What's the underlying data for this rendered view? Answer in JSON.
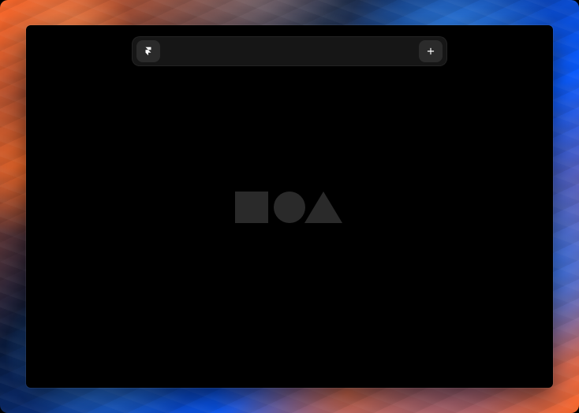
{
  "screen": {
    "wallpaper": "orange-blue-marbled"
  },
  "colors": {
    "window_background": "#000000",
    "top_bar_background": "#161616",
    "button_background": "#2b2b2b",
    "icon_foreground": "#ffffff",
    "placeholder_shapes": "#2a2a2a"
  },
  "top_bar": {
    "logo_icon": "framer-logo-icon",
    "add_icon": "plus-icon"
  },
  "center_placeholder": {
    "icons": [
      "square-icon",
      "circle-icon",
      "triangle-icon"
    ]
  }
}
